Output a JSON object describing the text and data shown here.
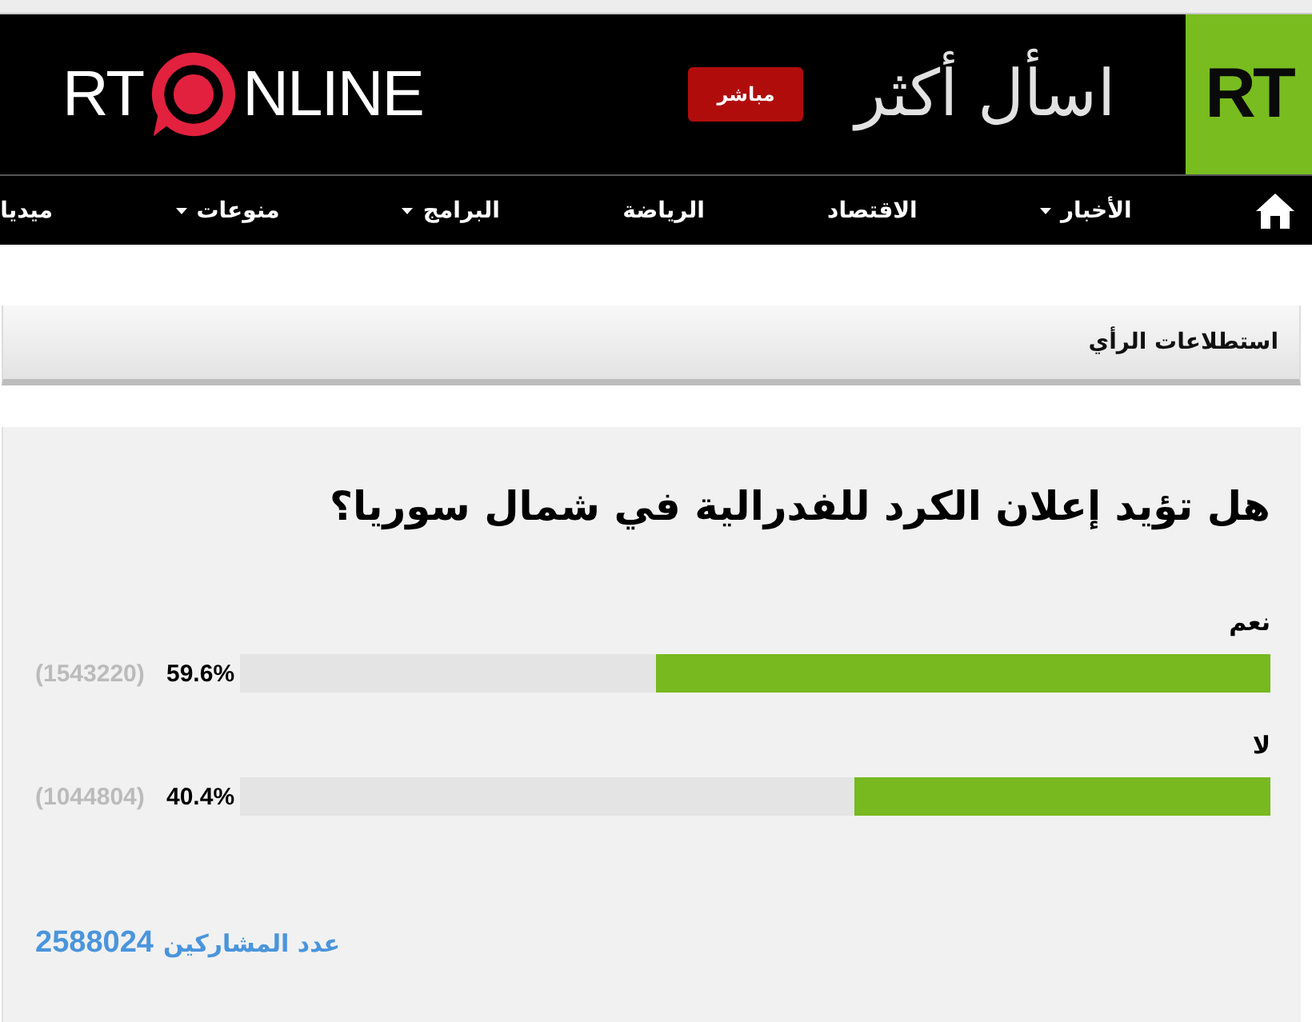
{
  "header": {
    "logo_left": {
      "part_1": "RT",
      "part_2": "NLINE"
    },
    "live_button": "مباشر",
    "slogan": "اسأل أكثر",
    "logo_right": "RT"
  },
  "nav": {
    "items": [
      {
        "label": "الأخبار",
        "has_menu": true
      },
      {
        "label": "الاقتصاد",
        "has_menu": false
      },
      {
        "label": "الرياضة",
        "has_menu": false
      },
      {
        "label": "البرامج",
        "has_menu": true
      },
      {
        "label": "منوعات",
        "has_menu": true
      },
      {
        "label": "ميديا",
        "has_menu": false
      }
    ]
  },
  "section": {
    "title": "استطلاعات الرأي"
  },
  "poll": {
    "question": "هل تؤيد إعلان الكرد للفدرالية في شمال سوريا؟",
    "options": [
      {
        "label": "نعم",
        "level": 0.596,
        "percent": "59.6%",
        "votes": "(1543220)"
      },
      {
        "label": "لا",
        "level": 0.404,
        "percent": "40.4%",
        "votes": "(1044804)"
      }
    ],
    "participants": {
      "label": "عدد المشاركين",
      "count": "2588024"
    }
  }
}
